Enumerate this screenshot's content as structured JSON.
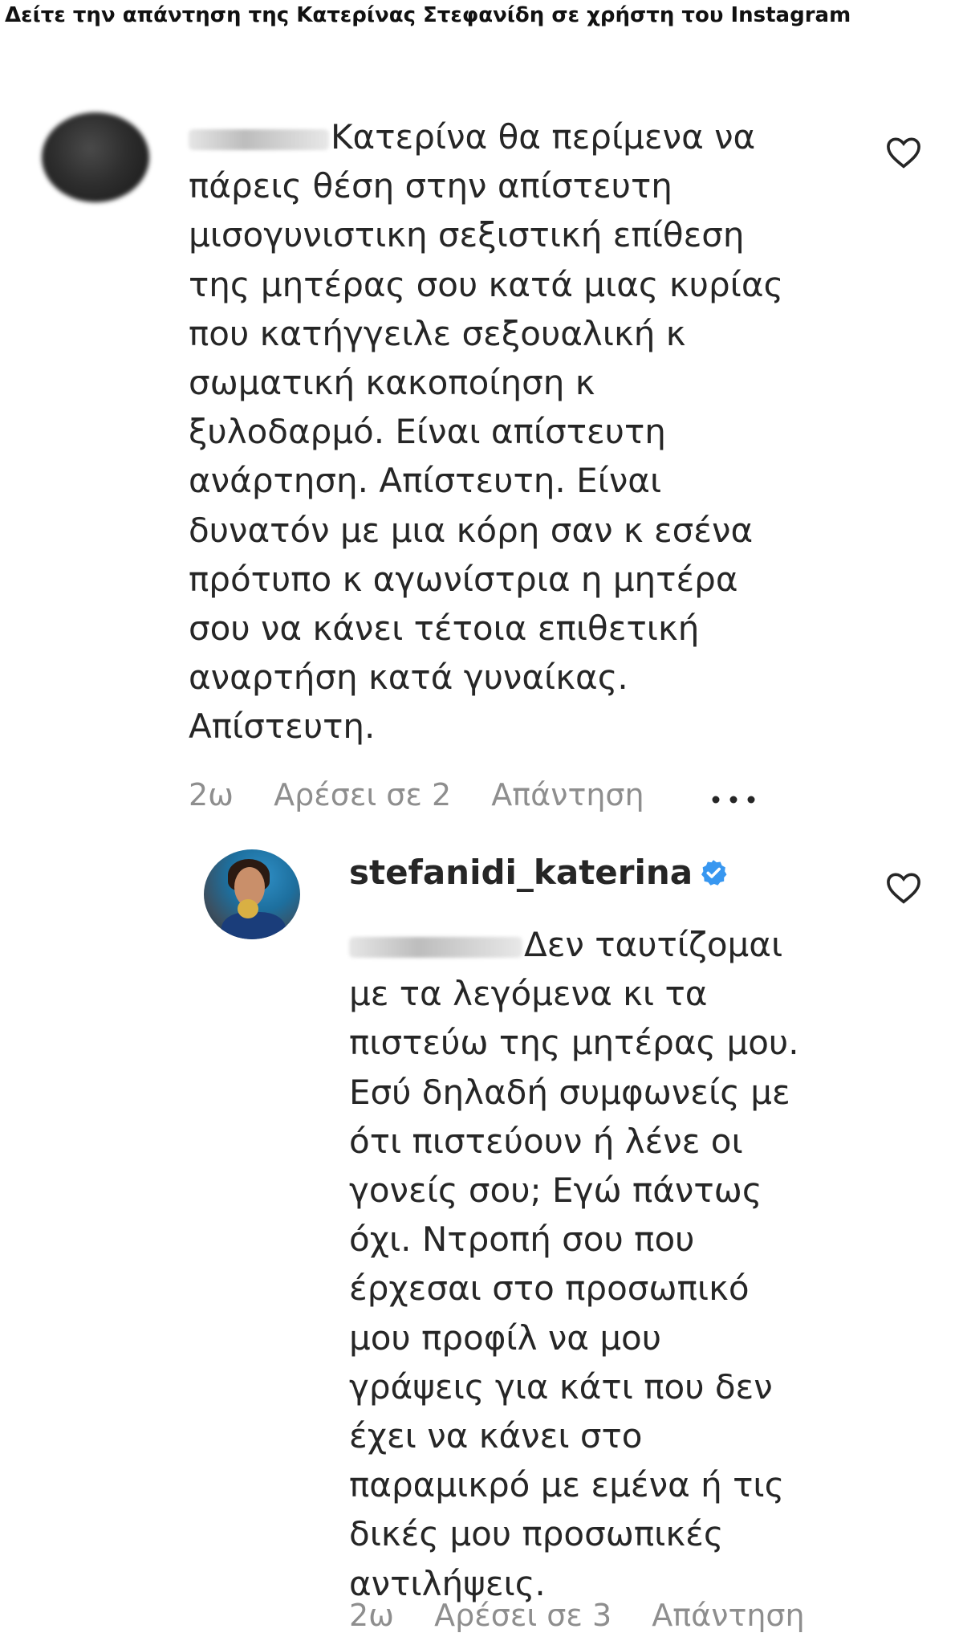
{
  "headline": "Δείτε την απάντηση της Κατερίνας Στεφανίδη σε χρήστη του Instagram",
  "comment": {
    "lines": [
      "Κατερίνα θα περίμενα να",
      "πάρεις θέση στην απίστευτη",
      "μισογυνιστικη σεξιστική επίθεση",
      "της μητέρας σου κατά μιας κυρίας",
      "που κατήγγειλε σεξουαλική κ",
      "σωματική κακοποίηση κ",
      "ξυλοδαρμό. Είναι απίστευτη",
      "ανάρτηση. Απίστευτη. Είναι",
      "δυνατόν με μια κόρη σαν κ εσένα",
      "πρότυπο κ αγωνίστρια η μητέρα",
      "σου να κάνει τέτοια επιθετική",
      "αναρτήση κατά γυναίκας.",
      "Απίστευτη."
    ],
    "time": "2ω",
    "likes": "Αρέσει σε 2",
    "reply": "Απάντηση"
  },
  "reply_comment": {
    "username": "stefanidi_katerina",
    "lines": [
      "Δεν ταυτίζομαι",
      "με τα λεγόμενα κι τα",
      "πιστεύω της μητέρας μου.",
      "Εσύ δηλαδή συμφωνείς με",
      "ότι πιστεύουν ή λένε οι",
      "γονείς σου; Εγώ πάντως",
      "όχι. Ντροπή σου που",
      "έρχεσαι στο προσωπικό",
      "μου προφίλ να μου",
      "γράψεις για κάτι που δεν",
      "έχει να κάνει στο",
      "παραμικρό με εμένα ή τις",
      "δικές μου προσωπικές",
      "αντιλήψεις."
    ],
    "time": "2ω",
    "likes": "Αρέσει σε 3",
    "reply": "Απάντηση"
  },
  "icons": {
    "like": "heart-outline-icon",
    "more": "more-options-icon",
    "verified": "verified-badge-icon"
  },
  "colors": {
    "verified": "#3897f0",
    "text": "#262626",
    "meta": "#8e8e8e"
  }
}
